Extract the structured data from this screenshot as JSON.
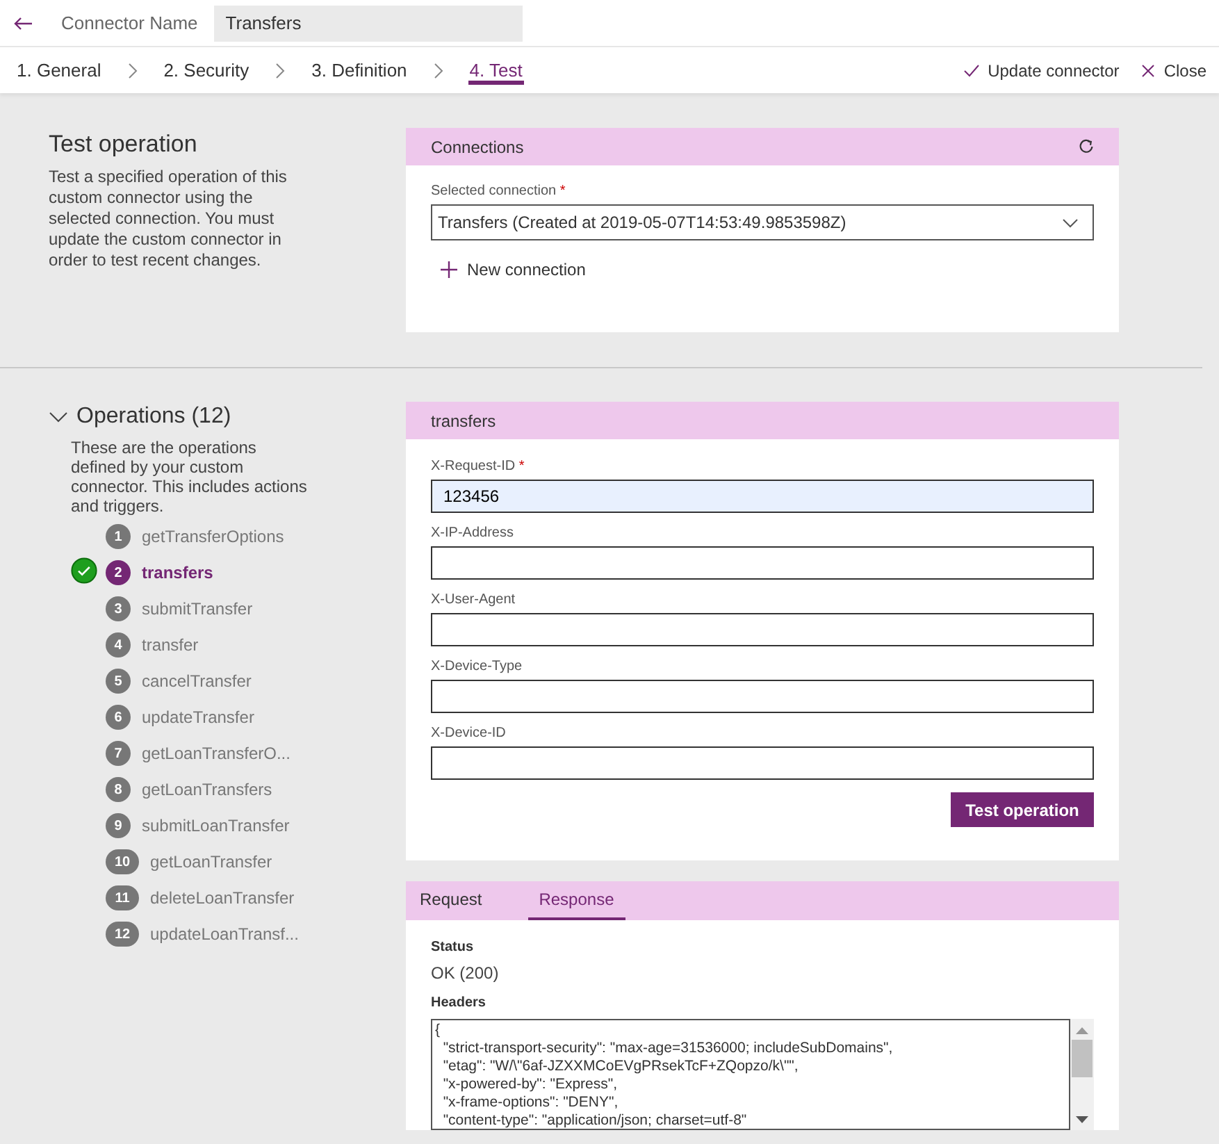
{
  "header": {
    "label": "Connector Name",
    "connector_name": "Transfers"
  },
  "steps": [
    {
      "label": "1. General",
      "selected": false
    },
    {
      "label": "2. Security",
      "selected": false
    },
    {
      "label": "3. Definition",
      "selected": false
    },
    {
      "label": "4. Test",
      "selected": true
    }
  ],
  "actions": [
    "Update connector",
    "Close"
  ],
  "test_operation": {
    "title": "Test operation",
    "description": "Test a specified operation of this custom connector using the selected connection. You must update the custom connector in order to test recent changes."
  },
  "connections": {
    "title": "Connections",
    "field_label": "Selected connection",
    "required_mark": "*",
    "selected_connection": "Transfers (Created at 2019-05-07T14:53:49.9853598Z)",
    "new_connection": "New connection"
  },
  "operations": {
    "title": "Operations (12)",
    "expanded": true,
    "description": "These are the operations defined by your custom connector. This includes actions and triggers.",
    "items": [
      {
        "number": "1",
        "name": "getTransferOptions",
        "selected": false,
        "passed": false
      },
      {
        "number": "2",
        "name": "transfers",
        "selected": true,
        "passed": true
      },
      {
        "number": "3",
        "name": "submitTransfer",
        "selected": false,
        "passed": false
      },
      {
        "number": "4",
        "name": "transfer",
        "selected": false,
        "passed": false
      },
      {
        "number": "5",
        "name": "cancelTransfer",
        "selected": false,
        "passed": false
      },
      {
        "number": "6",
        "name": "updateTransfer",
        "selected": false,
        "passed": false
      },
      {
        "number": "7",
        "name": "getLoanTransferO...",
        "selected": false,
        "passed": false
      },
      {
        "number": "8",
        "name": "getLoanTransfers",
        "selected": false,
        "passed": false
      },
      {
        "number": "9",
        "name": "submitLoanTransfer",
        "selected": false,
        "passed": false
      },
      {
        "number": "10",
        "name": "getLoanTransfer",
        "selected": false,
        "passed": false
      },
      {
        "number": "11",
        "name": "deleteLoanTransfer",
        "selected": false,
        "passed": false
      },
      {
        "number": "12",
        "name": "updateLoanTransf...",
        "selected": false,
        "passed": false
      }
    ]
  },
  "operation_form": {
    "title": "transfers",
    "fields": [
      {
        "label": "X-Request-ID",
        "required_mark": "*",
        "value": "123456",
        "autofilled": true
      },
      {
        "label": "X-IP-Address",
        "autofilled": false
      },
      {
        "label": "X-User-Agent",
        "autofilled": false
      },
      {
        "label": "X-Device-Type",
        "autofilled": false
      },
      {
        "label": "X-Device-ID",
        "autofilled": false
      }
    ],
    "button": "Test operation"
  },
  "result": {
    "tabs": [
      {
        "label": "Request",
        "selected": false
      },
      {
        "label": "Response",
        "selected": true
      }
    ],
    "status_label": "Status",
    "status": "OK (200)",
    "headers_label": "Headers",
    "headers_lines": [
      "{",
      "  \"strict-transport-security\": \"max-age=31536000; includeSubDomains\",",
      "  \"etag\": \"W/\\\"6af-JZXXMCoEVgPRsekTcF+ZQopzo/k\\\"\",",
      "  \"x-powered-by\": \"Express\",",
      "  \"x-frame-options\": \"DENY\",",
      "  \"content-type\": \"application/json; charset=utf-8\""
    ]
  }
}
